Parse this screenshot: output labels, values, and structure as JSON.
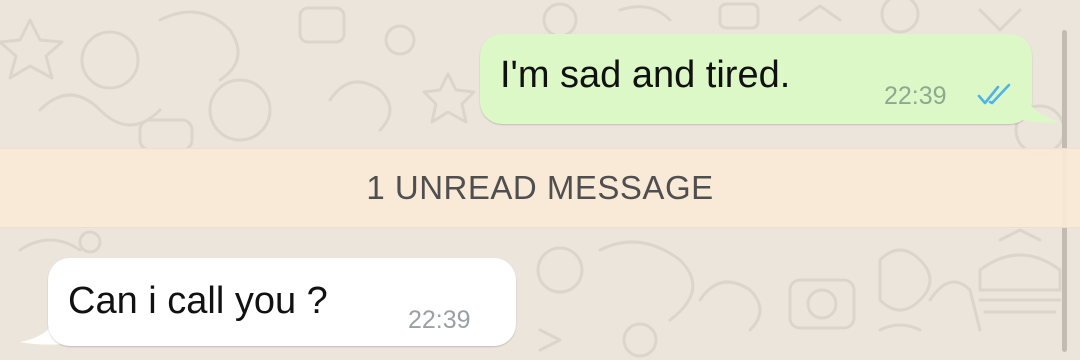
{
  "conversation": {
    "messages": [
      {
        "direction": "outgoing",
        "text": "I'm sad and tired.",
        "time": "22:39",
        "status_icon": "double-check-read-icon"
      },
      {
        "direction": "incoming",
        "text": "Can i call you ?",
        "time": "22:39"
      }
    ],
    "unread_divider": "1 UNREAD MESSAGE"
  },
  "colors": {
    "background": "#ece5dc",
    "outgoing_bubble": "#dcf8c6",
    "incoming_bubble": "#ffffff",
    "unread_bar": "#faead6",
    "read_ticks": "#4fb3e8"
  }
}
